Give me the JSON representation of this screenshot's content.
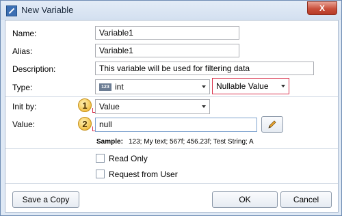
{
  "window": {
    "title": "New Variable",
    "close_label": "X"
  },
  "form": {
    "name_label": "Name:",
    "name_value": "Variable1",
    "alias_label": "Alias:",
    "alias_value": "Variable1",
    "description_label": "Description:",
    "description_value": "This variable will be used for filtering data",
    "type_label": "Type:",
    "type_icon_text": "123",
    "type_value": "int",
    "nullable_value": "Nullable Value",
    "init_label": "Init by:",
    "init_value": "Value",
    "value_label": "Value:",
    "value_value": "null",
    "sample_label": "Sample:",
    "sample_value": "123; My text; 567f; 456.23f; Test String; A",
    "readonly_label": "Read Only",
    "request_label": "Request from User"
  },
  "badges": [
    "1",
    "2"
  ],
  "buttons": {
    "save_copy": "Save a Copy",
    "ok": "OK",
    "cancel": "Cancel"
  },
  "colors": {
    "accent_red": "#d9334d",
    "badge": "#f3c24a"
  }
}
